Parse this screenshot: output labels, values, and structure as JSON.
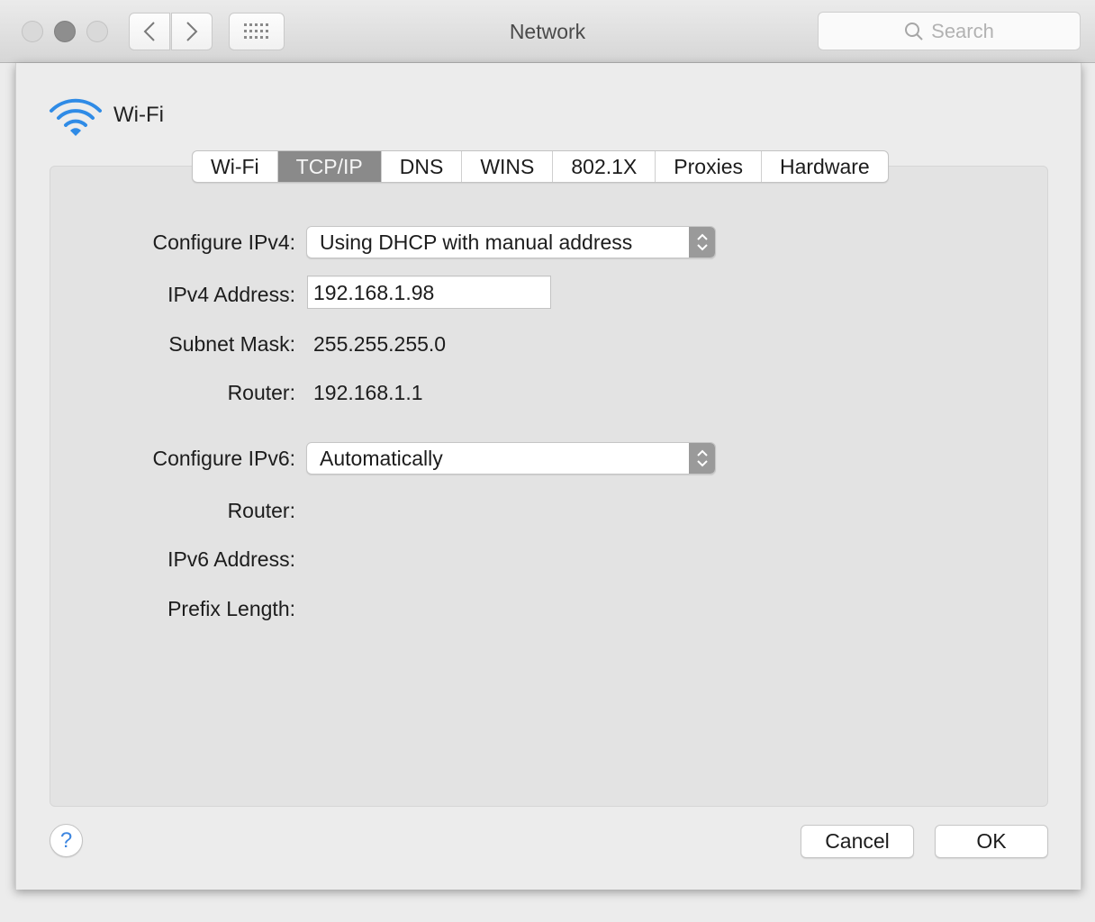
{
  "window": {
    "title": "Network",
    "search_placeholder": "Search"
  },
  "interface": {
    "name": "Wi-Fi",
    "icon": "wifi-icon",
    "accent_color": "#2f8be6"
  },
  "tabs": [
    {
      "label": "Wi-Fi",
      "active": false
    },
    {
      "label": "TCP/IP",
      "active": true
    },
    {
      "label": "DNS",
      "active": false
    },
    {
      "label": "WINS",
      "active": false
    },
    {
      "label": "802.1X",
      "active": false
    },
    {
      "label": "Proxies",
      "active": false
    },
    {
      "label": "Hardware",
      "active": false
    }
  ],
  "ipv4": {
    "configure_label": "Configure IPv4:",
    "configure_value": "Using DHCP with manual address",
    "address_label": "IPv4 Address:",
    "address_value": "192.168.1.98",
    "subnet_label": "Subnet Mask:",
    "subnet_value": "255.255.255.0",
    "router_label": "Router:",
    "router_value": "192.168.1.1"
  },
  "ipv6": {
    "configure_label": "Configure IPv6:",
    "configure_value": "Automatically",
    "router_label": "Router:",
    "address_label": "IPv6 Address:",
    "prefix_label": "Prefix Length:"
  },
  "buttons": {
    "help": "?",
    "cancel": "Cancel",
    "ok": "OK"
  }
}
